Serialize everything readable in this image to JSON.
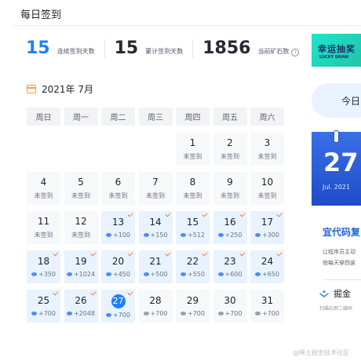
{
  "header": {
    "title": "每日签到"
  },
  "stats": [
    {
      "value": "15",
      "label": "连续签到天数"
    },
    {
      "value": "15",
      "label": "累计签到天数"
    },
    {
      "value": "1856",
      "label": "当前矿石数"
    }
  ],
  "info_icon_glyph": "i",
  "calendar": {
    "month_label": "2021年 7月",
    "weekdays": [
      "周日",
      "周一",
      "周二",
      "周三",
      "周四",
      "周五",
      "周六"
    ],
    "leading_blank": 4,
    "today": 27,
    "days": [
      {
        "day": "1",
        "sub": "未签到",
        "state": "unsigned"
      },
      {
        "day": "2",
        "sub": "未签到",
        "state": "unsigned"
      },
      {
        "day": "3",
        "sub": "未签到",
        "state": "unsigned"
      },
      {
        "day": "4",
        "sub": "未签到",
        "state": "unsigned"
      },
      {
        "day": "5",
        "sub": "未签到",
        "state": "unsigned"
      },
      {
        "day": "6",
        "sub": "未签到",
        "state": "unsigned"
      },
      {
        "day": "7",
        "sub": "未签到",
        "state": "unsigned"
      },
      {
        "day": "8",
        "sub": "未签到",
        "state": "unsigned"
      },
      {
        "day": "9",
        "sub": "未签到",
        "state": "unsigned"
      },
      {
        "day": "10",
        "sub": "未签到",
        "state": "unsigned"
      },
      {
        "day": "11",
        "sub": "未签到",
        "state": "unsigned"
      },
      {
        "day": "12",
        "sub": "未签到",
        "state": "unsigned"
      },
      {
        "day": "13",
        "sub": "+100",
        "state": "signed"
      },
      {
        "day": "14",
        "sub": "+150",
        "state": "signed"
      },
      {
        "day": "15",
        "sub": "+512",
        "state": "signed"
      },
      {
        "day": "16",
        "sub": "+250",
        "state": "signed"
      },
      {
        "day": "17",
        "sub": "+300",
        "state": "signed"
      },
      {
        "day": "18",
        "sub": "+350",
        "state": "signed"
      },
      {
        "day": "19",
        "sub": "+1024",
        "state": "signed"
      },
      {
        "day": "20",
        "sub": "+450",
        "state": "signed"
      },
      {
        "day": "21",
        "sub": "+500",
        "state": "signed"
      },
      {
        "day": "22",
        "sub": "+550",
        "state": "signed"
      },
      {
        "day": "23",
        "sub": "+600",
        "state": "signed"
      },
      {
        "day": "24",
        "sub": "+650",
        "state": "signed"
      },
      {
        "day": "25",
        "sub": "+700",
        "state": "signed"
      },
      {
        "day": "26",
        "sub": "+2048",
        "state": "signed"
      },
      {
        "day": "27",
        "sub": "+700",
        "state": "signed-today"
      },
      {
        "day": "28",
        "sub": "+700",
        "state": "future"
      },
      {
        "day": "29",
        "sub": "+700",
        "state": "future"
      },
      {
        "day": "30",
        "sub": "+700",
        "state": "future"
      },
      {
        "day": "31",
        "sub": "+700",
        "state": "future"
      }
    ]
  },
  "lucky_draw": {
    "title": "幸运抽奖",
    "subtitle": "LUCKY DRAW"
  },
  "today_button": {
    "label": "今日"
  },
  "promo": {
    "big_day": "27",
    "month_year": "Jul. 2021",
    "headline": "宜代码复",
    "lines": [
      "让程序员主动",
      "他每天穿西装"
    ],
    "brand": "掘金",
    "scan_text": "扫描右侧二维码"
  },
  "watermark": "@稀土掘金技术社区",
  "colors": {
    "accent": "#1e80ff",
    "check": "#ff7a2e",
    "signed_bg": "#e8f3ff"
  }
}
